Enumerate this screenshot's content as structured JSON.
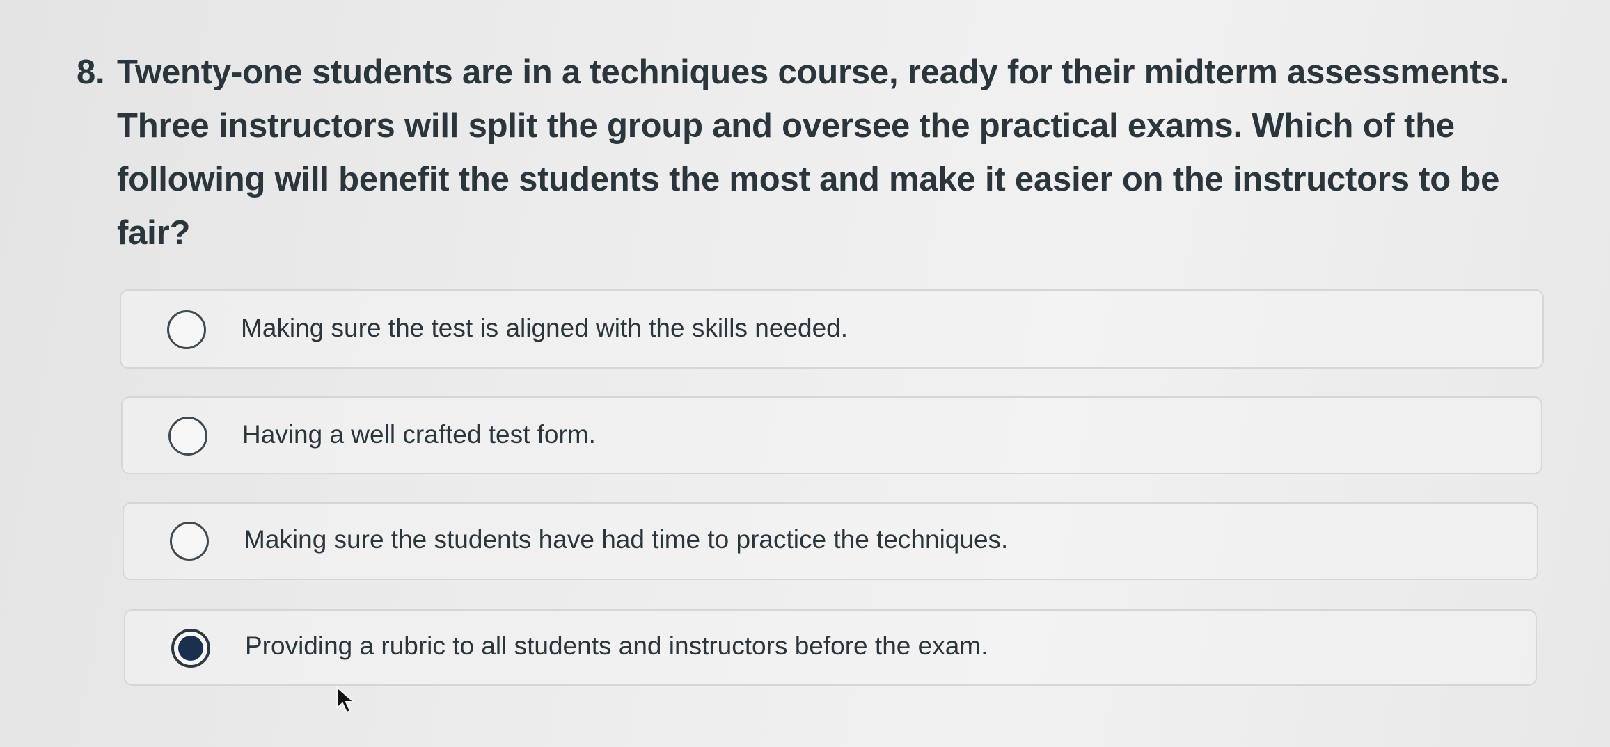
{
  "question": {
    "number": "8.",
    "text": "Twenty-one students are in a techniques course, ready for their midterm assessments. Three instructors will split the group and oversee the practical exams. Which of the following will benefit the students the most and make it easier on the instructors to be fair?"
  },
  "answers": [
    {
      "label": "Making sure the test is aligned with the skills needed.",
      "selected": false
    },
    {
      "label": "Having a well crafted test form.",
      "selected": false
    },
    {
      "label": "Making sure the students have had time to practice the techniques.",
      "selected": false
    },
    {
      "label": "Providing a rubric to all students and instructors before the exam.",
      "selected": true
    }
  ],
  "colors": {
    "text": "#2a353c",
    "selected_radio_fill": "#1b2f4e",
    "border": "#d6d6d6"
  },
  "icons": {
    "cursor": "mouse-pointer-icon",
    "radio": "radio-circle-icon"
  }
}
